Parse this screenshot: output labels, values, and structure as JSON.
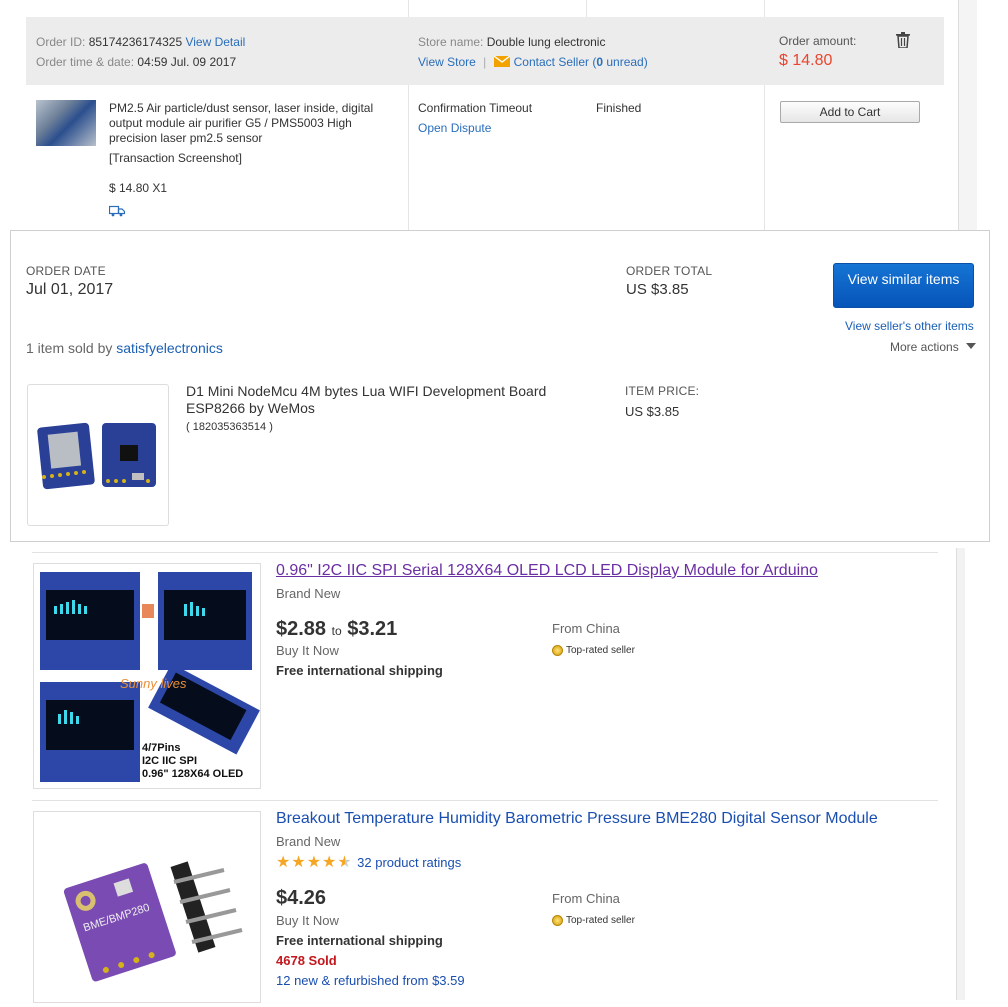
{
  "ali_order": {
    "order_id_label": "Order ID:",
    "order_id": "85174236174325",
    "view_detail": "View Detail",
    "order_time_label": "Order time & date:",
    "order_time": "04:59 Jul. 09 2017",
    "store_name_label": "Store name:",
    "store_name": "Double lung electronic",
    "view_store": "View Store",
    "separator": "|",
    "contact_seller": "Contact Seller (",
    "unread_count": "0",
    "unread_suffix": " unread)",
    "amount_label": "Order amount:",
    "amount": "$ 14.80",
    "product_title": "PM2.5 Air particle/dust sensor, laser inside, digital output module air purifier G5 / PMS5003 High precision laser pm2.5 sensor",
    "transaction_screenshot": "[Transaction Screenshot]",
    "price_qty": "$ 14.80 X1",
    "confirmation_timeout": "Confirmation Timeout",
    "open_dispute": "Open Dispute",
    "status": "Finished",
    "add_to_cart": "Add to Cart",
    "accent_color": "#e9452f"
  },
  "ebay_order": {
    "order_date_label": "ORDER DATE",
    "order_date": "Jul 01, 2017",
    "order_total_label": "ORDER TOTAL",
    "order_total": "US $3.85",
    "view_similar": "View similar items",
    "view_seller_other": "View seller's other items",
    "more_actions": "More actions",
    "sold_by_prefix": "1 item sold by ",
    "seller": "satisfyelectronics",
    "item_title": "D1 Mini NodeMcu 4M bytes Lua WIFI Development Board ESP8266 by WeMos",
    "item_number": "( 182035363514 )",
    "item_price_label": "ITEM PRICE:",
    "item_price": "US $3.85"
  },
  "listings": [
    {
      "title": "0.96\" I2C IIC SPI Serial 128X64 OLED LCD LED Display Module for Arduino",
      "condition": "Brand New",
      "price_low": "$2.88",
      "price_to": "to",
      "price_high": "$3.21",
      "format": "Buy It Now",
      "shipping": "Free international shipping",
      "from": "From China",
      "badge": "Top-rated seller",
      "img_caption_1": "4/7Pins",
      "img_caption_2": "I2C IIC SPI",
      "img_caption_3": "0.96\" 128X64 OLED",
      "img_watermark": "Sunny lives"
    },
    {
      "title": "Breakout Temperature Humidity Barometric Pressure BME280 Digital Sensor Module",
      "condition": "Brand New",
      "stars": "★★★★★",
      "rating_value": 4.5,
      "ratings": "32 product ratings",
      "price": "$4.26",
      "format": "Buy It Now",
      "shipping": "Free international shipping",
      "sold": "4678 Sold",
      "refurb": "12 new & refurbished from $3.59",
      "from": "From China",
      "badge": "Top-rated seller",
      "board_label": "BME/BMP280"
    }
  ]
}
